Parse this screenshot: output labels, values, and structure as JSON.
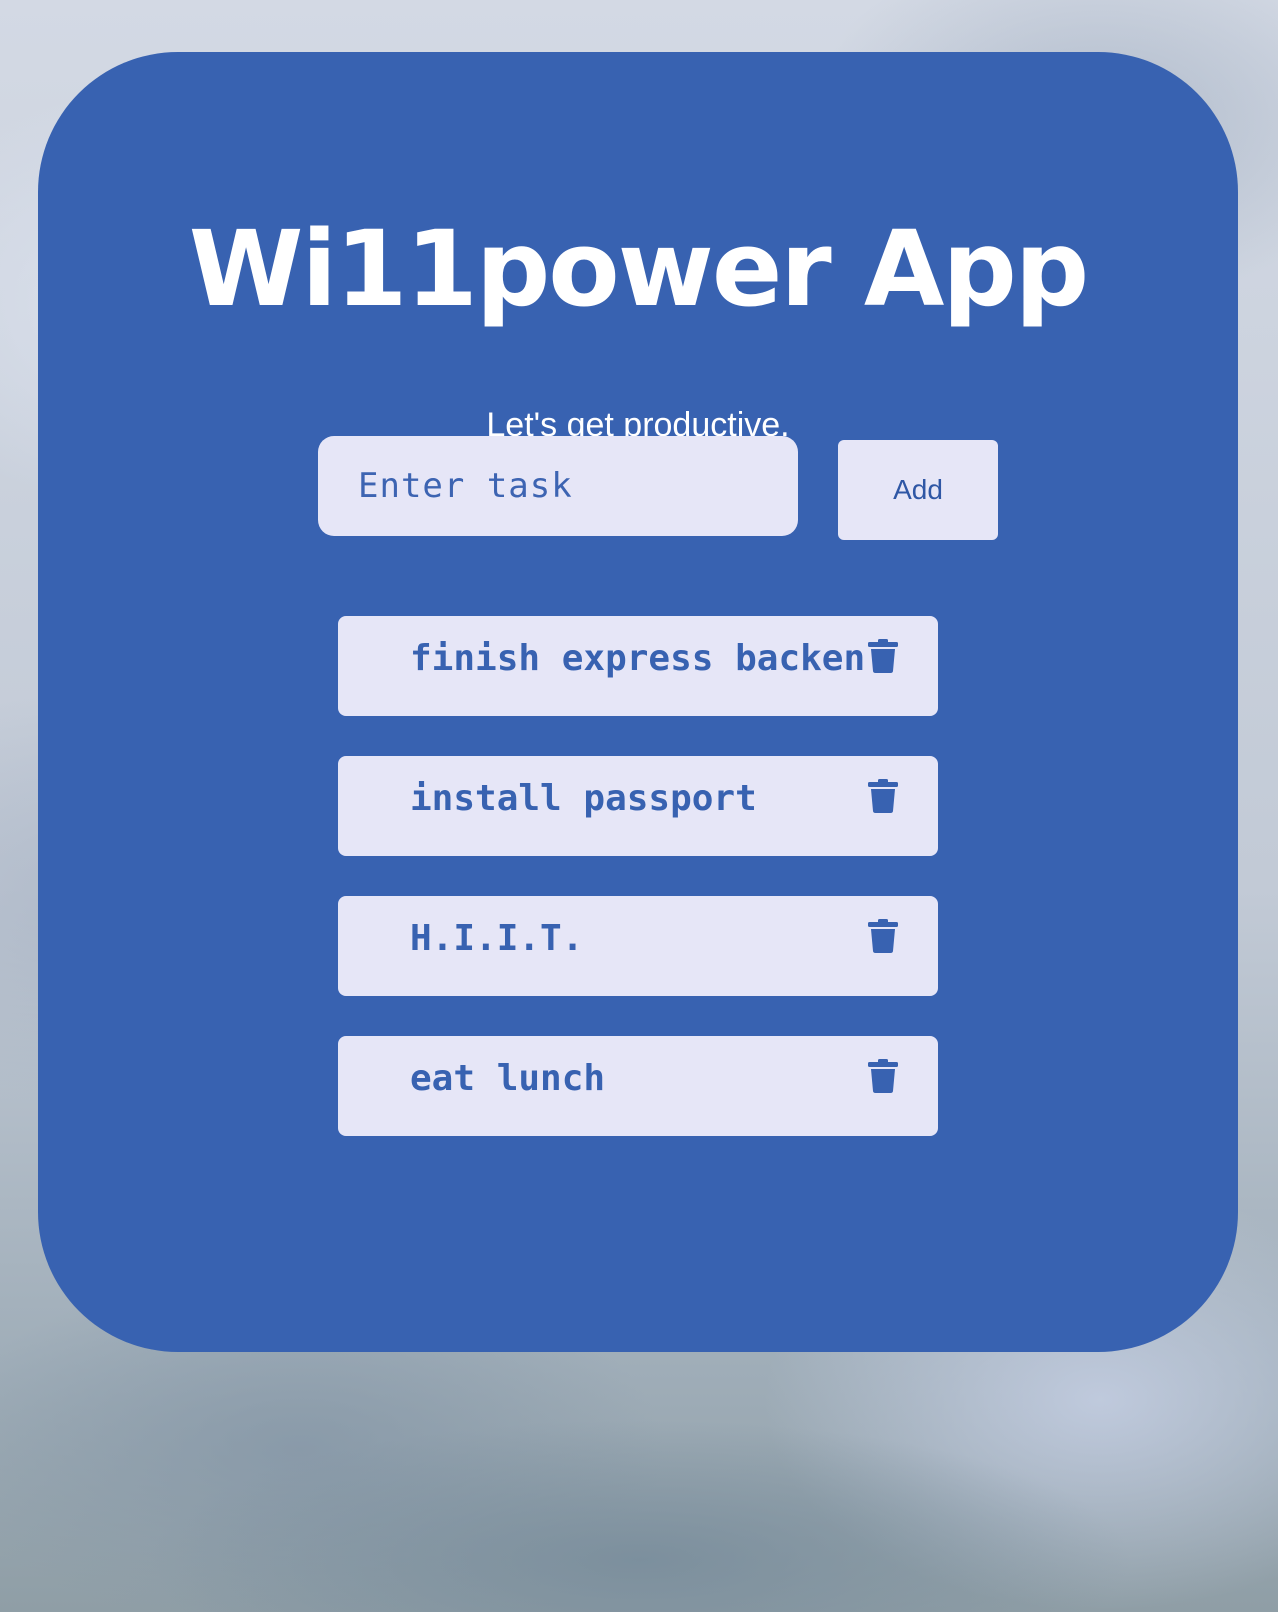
{
  "app": {
    "title": "Wi11power App",
    "subtitle": "Let's get productive."
  },
  "form": {
    "input_placeholder": "Enter task",
    "input_value": "",
    "add_label": "Add"
  },
  "tasks": [
    {
      "text": "finish express backen",
      "delete_icon": "trash-icon"
    },
    {
      "text": "install passport",
      "delete_icon": "trash-icon"
    },
    {
      "text": "H.I.I.T.",
      "delete_icon": "trash-icon"
    },
    {
      "text": "eat lunch",
      "delete_icon": "trash-icon"
    }
  ],
  "colors": {
    "card": "#3862b1",
    "surface": "#e6e6f7",
    "text_on_card": "#ffffff",
    "accent_text": "#3862b1"
  }
}
